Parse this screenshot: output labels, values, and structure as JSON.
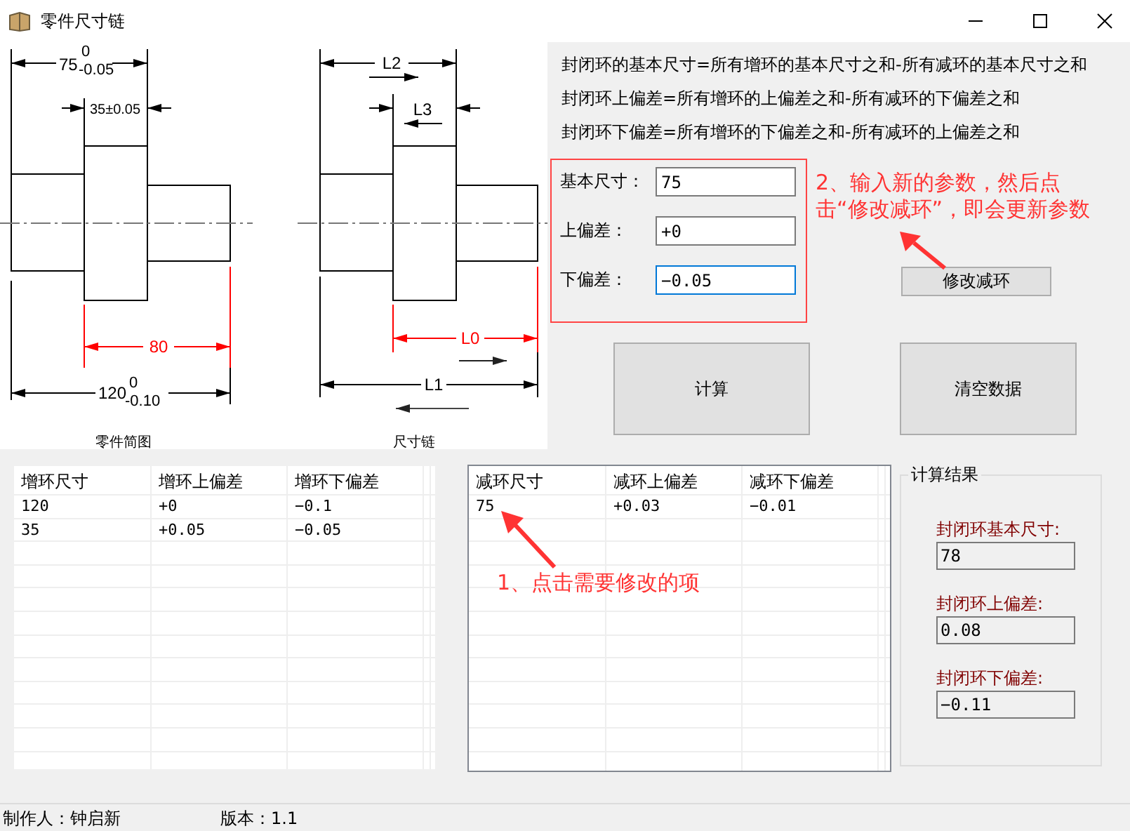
{
  "window": {
    "title": "零件尺寸链"
  },
  "part_sketch": {
    "caption": "零件简图",
    "left_length": {
      "value": "75",
      "upper": "0",
      "lower": "-0.05"
    },
    "middle_length": "35±0.05",
    "closing_length": "80",
    "overall_length": {
      "value": "120",
      "upper": "0",
      "lower": "-0.10"
    }
  },
  "chain_sketch": {
    "caption": "尺寸链",
    "l2": "L2",
    "l3": "L3",
    "l0": "L0",
    "l1": "L1"
  },
  "formulas": [
    "封闭环的基本尺寸=所有增环的基本尺寸之和-所有减环的基本尺寸之和",
    "封闭环上偏差=所有增环的上偏差之和-所有减环的下偏差之和",
    "封闭环下偏差=所有增环的下偏差之和-所有减环的上偏差之和"
  ],
  "input_form": {
    "fields": [
      {
        "label": "基本尺寸：",
        "value": "75",
        "focused": false
      },
      {
        "label": "上偏差：",
        "value": "+0",
        "focused": false
      },
      {
        "label": "下偏差：",
        "value": "−0.05",
        "focused": true
      }
    ]
  },
  "hint_2": {
    "lines": [
      "2、输入新的参数，然后点",
      "击“修改减环”，即会更新参数"
    ]
  },
  "modify_button": "修改减环",
  "calc_button": "计算",
  "clear_button": "清空数据",
  "increase_table": {
    "columns": [
      "增环尺寸",
      "增环上偏差",
      "增环下偏差"
    ],
    "rows": [
      [
        "120",
        "+0",
        "−0.1"
      ],
      [
        "35",
        "+0.05",
        "−0.05"
      ]
    ]
  },
  "decrease_table": {
    "columns": [
      "减环尺寸",
      "减环上偏差",
      "减环下偏差"
    ],
    "rows": [
      [
        "75",
        "+0.03",
        "−0.01"
      ]
    ]
  },
  "hint_1": "1、点击需要修改的项",
  "results": {
    "title": "计算结果",
    "fields": [
      {
        "label": "封闭环基本尺寸:",
        "value": "78"
      },
      {
        "label": "封闭环上偏差:",
        "value": "0.08"
      },
      {
        "label": "封闭环下偏差:",
        "value": "−0.11"
      }
    ]
  },
  "status_bar": [
    "制作人：钟启新",
    "版本：1.1"
  ]
}
